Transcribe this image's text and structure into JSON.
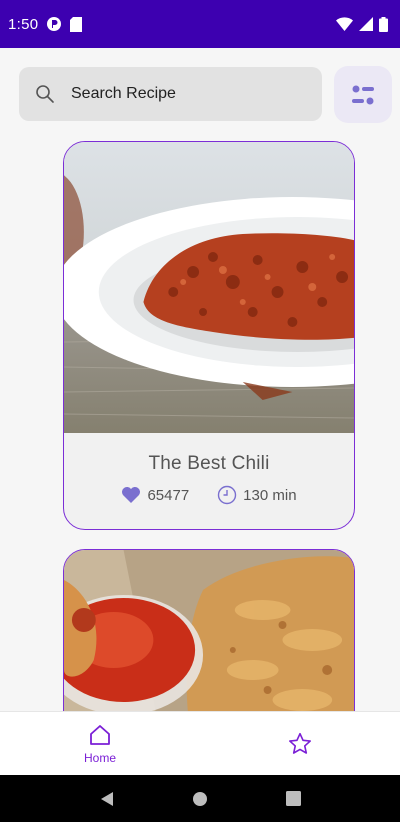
{
  "status_bar": {
    "time": "1:50"
  },
  "search": {
    "placeholder": "Search Recipe"
  },
  "recipes": [
    {
      "title": "The Best Chili",
      "likes": "65477",
      "time": "130 min"
    },
    {
      "title": "",
      "likes": "",
      "time": ""
    }
  ],
  "bottom_nav": {
    "items": [
      {
        "label": "Home",
        "icon": "home-icon",
        "active": true
      },
      {
        "label": "",
        "icon": "star-icon",
        "active": false
      }
    ]
  },
  "colors": {
    "primary": "#3d00b0",
    "accent": "#7b1fd6",
    "icon_fill": "#7a6fcf"
  }
}
